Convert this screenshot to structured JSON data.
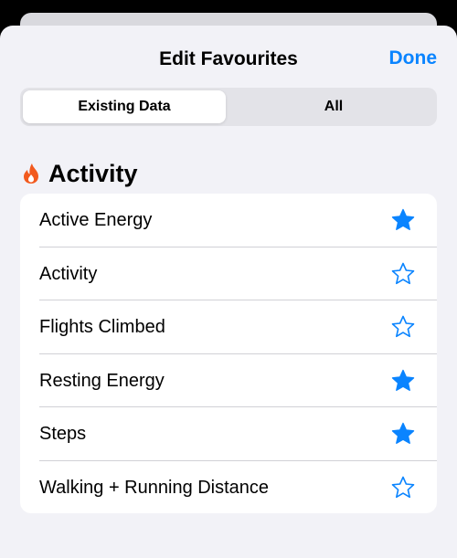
{
  "nav": {
    "title": "Edit Favourites",
    "done_label": "Done"
  },
  "segmented": {
    "options": [
      "Existing Data",
      "All"
    ],
    "selected": "Existing Data"
  },
  "section": {
    "title": "Activity",
    "icon": "flame-icon",
    "icon_color": "#f25a1e"
  },
  "items": [
    {
      "label": "Active Energy",
      "favourite": true
    },
    {
      "label": "Activity",
      "favourite": false
    },
    {
      "label": "Flights Climbed",
      "favourite": false
    },
    {
      "label": "Resting Energy",
      "favourite": true
    },
    {
      "label": "Steps",
      "favourite": true
    },
    {
      "label": "Walking + Running Distance",
      "favourite": false
    }
  ],
  "colors": {
    "accent": "#0a84ff",
    "background": "#f2f2f7"
  }
}
